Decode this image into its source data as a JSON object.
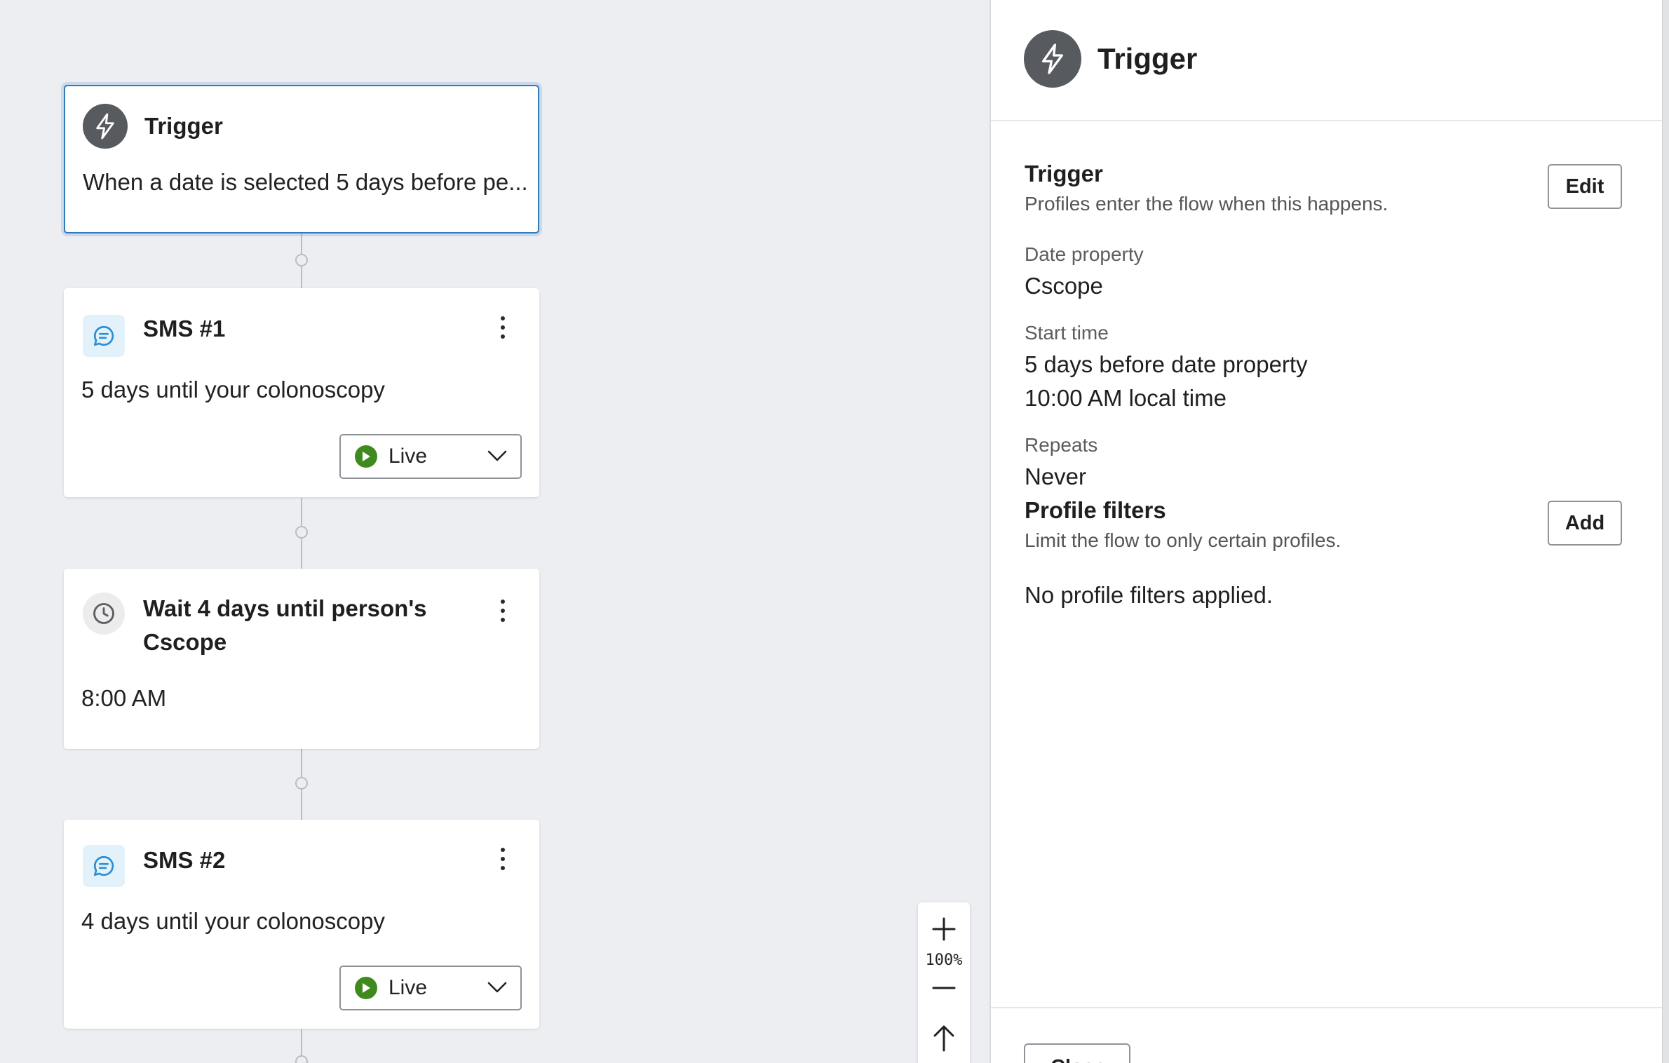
{
  "flow": {
    "trigger_card": {
      "title": "Trigger",
      "description": "When a date is selected 5 days before pe..."
    },
    "sms1": {
      "title": "SMS #1",
      "body": "5 days until your colonoscopy",
      "status": "Live"
    },
    "wait": {
      "title_line1": "Wait 4 days until person's",
      "title_line2": "Cscope",
      "time": "8:00 AM"
    },
    "sms2": {
      "title": "SMS #2",
      "body": "4 days until your colonoscopy",
      "status": "Live"
    }
  },
  "zoom": {
    "level": "100%"
  },
  "panel": {
    "title": "Trigger",
    "trigger_section": {
      "heading": "Trigger",
      "description": "Profiles enter the flow when this happens.",
      "edit_label": "Edit"
    },
    "date_property": {
      "label": "Date property",
      "value": "Cscope"
    },
    "start_time": {
      "label": "Start time",
      "line1": "5 days before date property",
      "line2": "10:00 AM local time"
    },
    "repeats": {
      "label": "Repeats",
      "value": "Never"
    },
    "profile_filters": {
      "heading": "Profile filters",
      "description": "Limit the flow to only certain profiles.",
      "add_label": "Add",
      "empty": "No profile filters applied."
    },
    "footer": {
      "button_label": "Close"
    }
  },
  "colors": {
    "canvas_bg": "#eceef1",
    "selected_border": "#2f7ab8",
    "live_green": "#3f8a1e",
    "sms_icon_blue": "#2b8fd6",
    "dark_icon": "#575a5e"
  },
  "icons": {
    "trigger": "lightning-icon",
    "sms": "message-bubble-icon",
    "wait": "clock-icon",
    "status": "play-icon",
    "dropdown": "chevron-down-icon",
    "more": "kebab-menu-icon",
    "zoom_in": "plus-icon",
    "zoom_out": "minus-icon",
    "recenter": "arrow-up-icon"
  }
}
